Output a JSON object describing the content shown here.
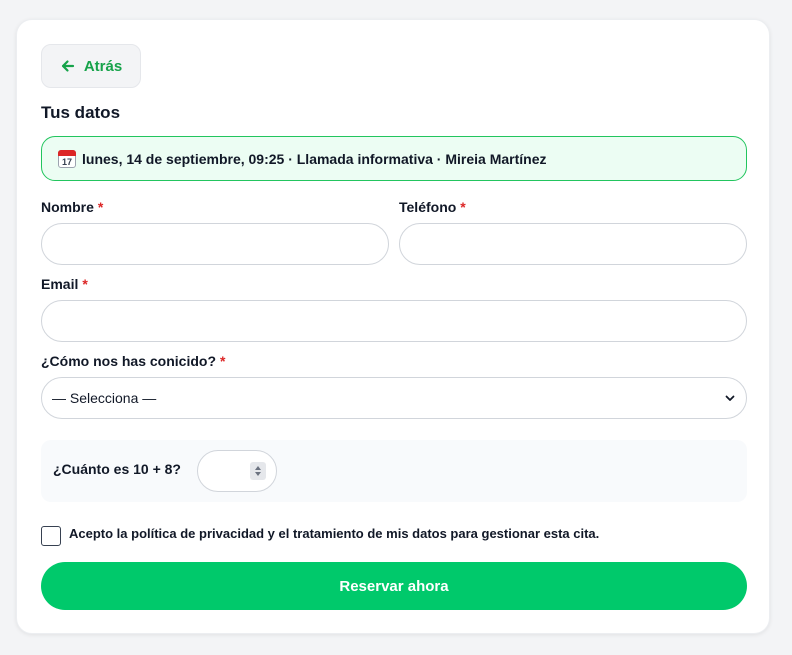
{
  "back": {
    "label": "Atrás",
    "icon": "arrow-left-icon"
  },
  "section_title": "Tus datos",
  "summary": {
    "icon": "calendar-icon",
    "icon_day": "17",
    "text": "lunes, 14 de septiembre, 09:25 · Llamada informativa · Mireia Martínez"
  },
  "fields": {
    "name": {
      "label": "Nombre",
      "required": "*",
      "value": ""
    },
    "phone": {
      "label": "Teléfono",
      "required": "*",
      "value": ""
    },
    "email": {
      "label": "Email",
      "required": "*",
      "value": ""
    },
    "source": {
      "label": "¿Cómo nos has conicido?",
      "required": "*",
      "selected": "— Selecciona —"
    }
  },
  "captcha": {
    "question": "¿Cuánto es 10 + 8?",
    "value": ""
  },
  "consent": {
    "text": "Acepto la política de privacidad y el tratamiento de mis datos para gestionar esta cita."
  },
  "submit": {
    "label": "Reservar ahora"
  },
  "colors": {
    "accent": "#00c96b",
    "accent_text": "#16a34a",
    "summary_bg": "#ecfdf3",
    "required": "#dc2626"
  }
}
